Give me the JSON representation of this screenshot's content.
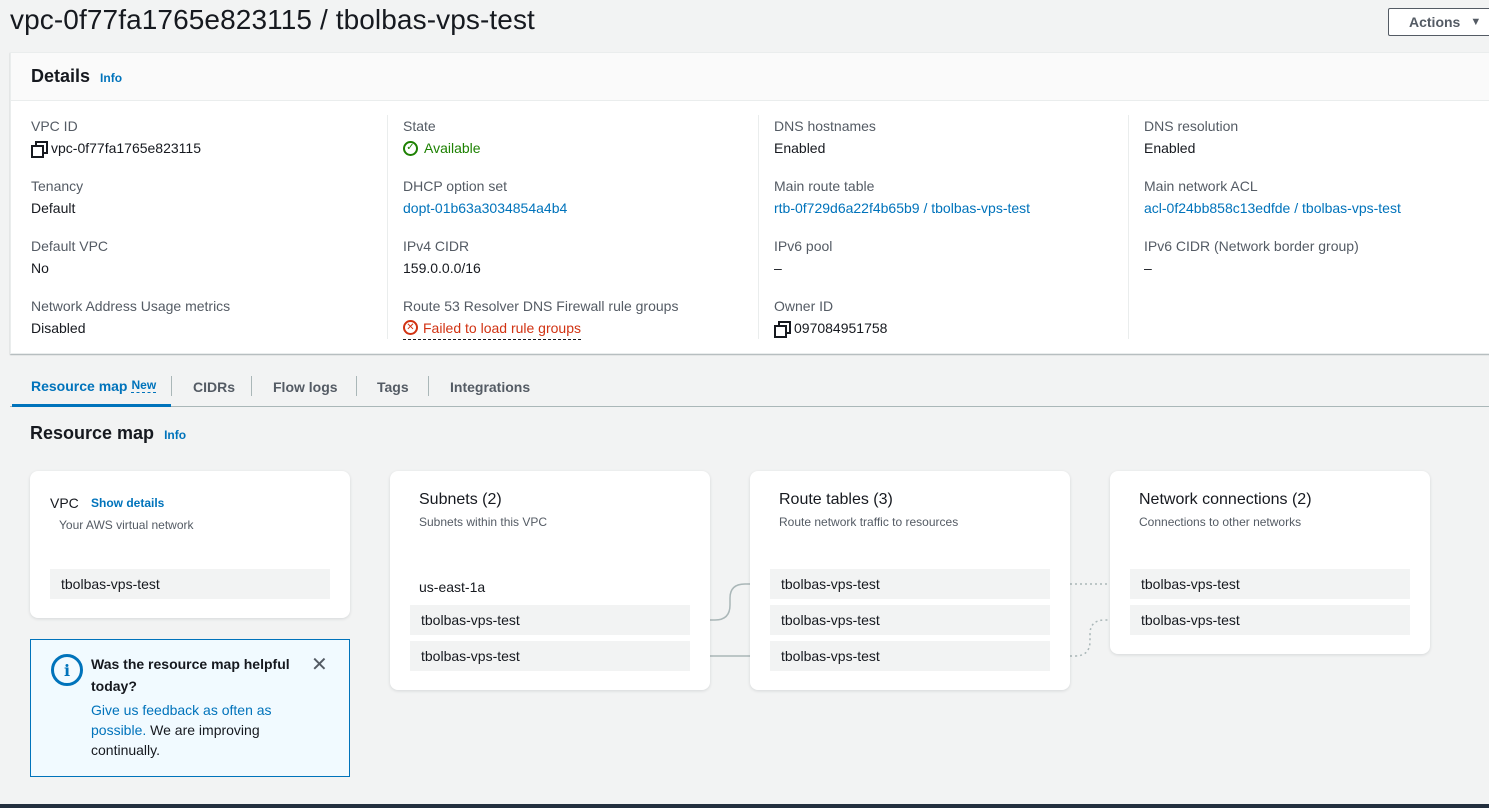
{
  "header": {
    "title": "vpc-0f77fa1765e823115 / tbolbas-vps-test",
    "actions_label": "Actions"
  },
  "details": {
    "title": "Details",
    "info_label": "Info",
    "col1": [
      {
        "label": "VPC ID",
        "value": "vpc-0f77fa1765e823115"
      },
      {
        "label": "Tenancy",
        "value": "Default"
      },
      {
        "label": "Default VPC",
        "value": "No"
      },
      {
        "label": "Network Address Usage metrics",
        "value": "Disabled"
      }
    ],
    "col2": [
      {
        "label": "State",
        "value": "Available"
      },
      {
        "label": "DHCP option set",
        "value": "dopt-01b63a3034854a4b4"
      },
      {
        "label": "IPv4 CIDR",
        "value": "159.0.0.0/16"
      },
      {
        "label": "Route 53 Resolver DNS Firewall rule groups",
        "value": "Failed to load rule groups"
      }
    ],
    "col3": [
      {
        "label": "DNS hostnames",
        "value": "Enabled"
      },
      {
        "label": "Main route table",
        "value": "rtb-0f729d6a22f4b65b9 / tbolbas-vps-test"
      },
      {
        "label": "IPv6 pool",
        "value": "–"
      },
      {
        "label": "Owner ID",
        "value": "097084951758"
      }
    ],
    "col4": [
      {
        "label": "DNS resolution",
        "value": "Enabled"
      },
      {
        "label": "Main network ACL",
        "value": "acl-0f24bb858c13edfde / tbolbas-vps-test"
      },
      {
        "label": "IPv6 CIDR (Network border group)",
        "value": "–"
      }
    ]
  },
  "tabs": [
    {
      "label": "Resource map",
      "badge": "New"
    },
    {
      "label": "CIDRs"
    },
    {
      "label": "Flow logs"
    },
    {
      "label": "Tags"
    },
    {
      "label": "Integrations"
    }
  ],
  "resource_map": {
    "title": "Resource map",
    "info_label": "Info",
    "vpc": {
      "title": "VPC",
      "show_details": "Show details",
      "subtitle": "Your AWS virtual network",
      "item": "tbolbas-vps-test"
    },
    "subnets": {
      "title": "Subnets (2)",
      "subtitle": "Subnets within this VPC",
      "az": "us-east-1a",
      "items": [
        "tbolbas-vps-test",
        "tbolbas-vps-test"
      ]
    },
    "route_tables": {
      "title": "Route tables (3)",
      "subtitle": "Route network traffic to resources",
      "items": [
        "tbolbas-vps-test",
        "tbolbas-vps-test",
        "tbolbas-vps-test"
      ]
    },
    "network_connections": {
      "title": "Network connections (2)",
      "subtitle": "Connections to other networks",
      "items": [
        "tbolbas-vps-test",
        "tbolbas-vps-test"
      ]
    },
    "feedback": {
      "title": "Was the resource map helpful today?",
      "link": "Give us feedback as often as possible.",
      "body": " We are improving continually."
    }
  },
  "colors": {
    "link": "#0073bb",
    "success": "#1d8102",
    "error": "#d13212"
  }
}
